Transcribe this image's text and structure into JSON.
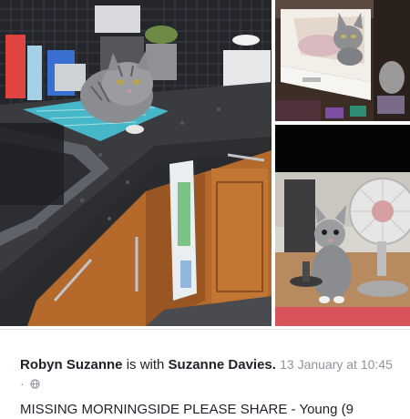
{
  "post": {
    "author": "Robyn Suzanne",
    "with_text": "is with",
    "tagged": "Suzanne Davies.",
    "date": "13 January at 10:45",
    "separator": "·",
    "privacy_icon": "globe-icon",
    "body_text": "MISSING MORNINGSIDE PLEASE SHARE - Young (9"
  },
  "photos": [
    {
      "subject": "grey tabby cat on kitchen counter"
    },
    {
      "subject": "grey tabby kitten in open drawer"
    },
    {
      "subject": "grey tabby kitten beside desk fan"
    }
  ],
  "colors": {
    "text": "#1d2129",
    "meta": "#90949c",
    "cabinet_wood": "#b5692a",
    "countertop": "#3a3b3f",
    "mat": "#46b7c9",
    "rug": "#d9535b"
  }
}
